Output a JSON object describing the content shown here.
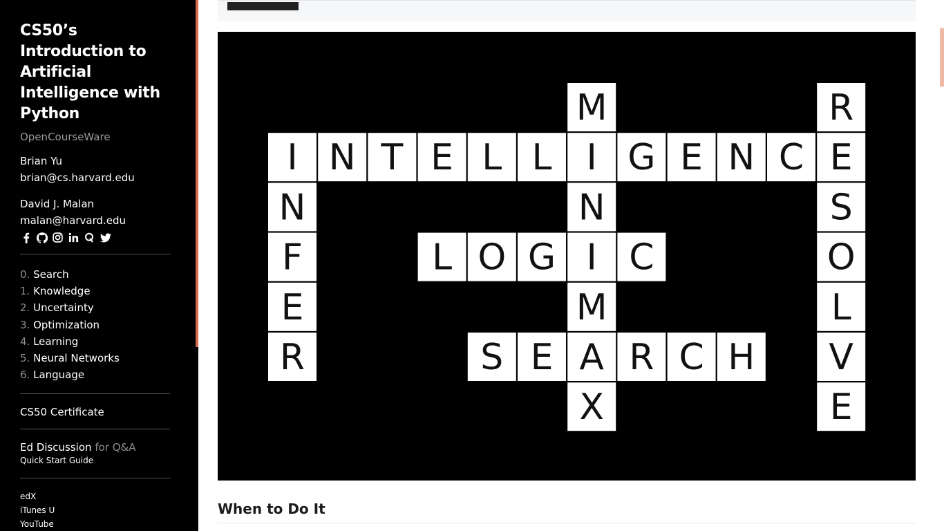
{
  "sidebar": {
    "title_lines": [
      "CS50’s",
      "Introduction to",
      "Artificial",
      "Intelligence with",
      "Python"
    ],
    "subtitle": "OpenCourseWare",
    "instructors": [
      {
        "name": "Brian Yu",
        "email": "brian@cs.harvard.edu"
      },
      {
        "name": "David J. Malan",
        "email": "malan@harvard.edu"
      }
    ],
    "social_icons": [
      "facebook-icon",
      "github-icon",
      "instagram-icon",
      "linkedin-icon",
      "quora-icon",
      "twitter-icon"
    ],
    "weeks": [
      {
        "num": "0.",
        "label": "Search"
      },
      {
        "num": "1.",
        "label": "Knowledge"
      },
      {
        "num": "2.",
        "label": "Uncertainty"
      },
      {
        "num": "3.",
        "label": "Optimization"
      },
      {
        "num": "4.",
        "label": "Learning"
      },
      {
        "num": "5.",
        "label": "Neural Networks"
      },
      {
        "num": "6.",
        "label": "Language"
      }
    ],
    "certificate": "CS50 Certificate",
    "ed_discussion": "Ed Discussion",
    "ed_suffix": "for Q&A",
    "quick_start": "Quick Start Guide",
    "platforms": [
      "edX",
      "iTunes U",
      "YouTube"
    ]
  },
  "main": {
    "section_heading": "When to Do It"
  },
  "crossword": {
    "words": [
      {
        "word": "INTELLIGENCE",
        "dir": "across",
        "row": 1,
        "col": 0
      },
      {
        "word": "INFER",
        "dir": "down",
        "row": 1,
        "col": 0
      },
      {
        "word": "MINIMAX",
        "dir": "down",
        "row": 0,
        "col": 6
      },
      {
        "word": "LOGIC",
        "dir": "across",
        "row": 3,
        "col": 3
      },
      {
        "word": "SEARCH",
        "dir": "across",
        "row": 5,
        "col": 4
      },
      {
        "word": "RESOLVE",
        "dir": "down",
        "row": 0,
        "col": 11
      }
    ]
  },
  "colors": {
    "sidebar_bg": "#000000",
    "accent": "#d66a4e",
    "tile": "#ffffff",
    "tile_text": "#111111"
  }
}
